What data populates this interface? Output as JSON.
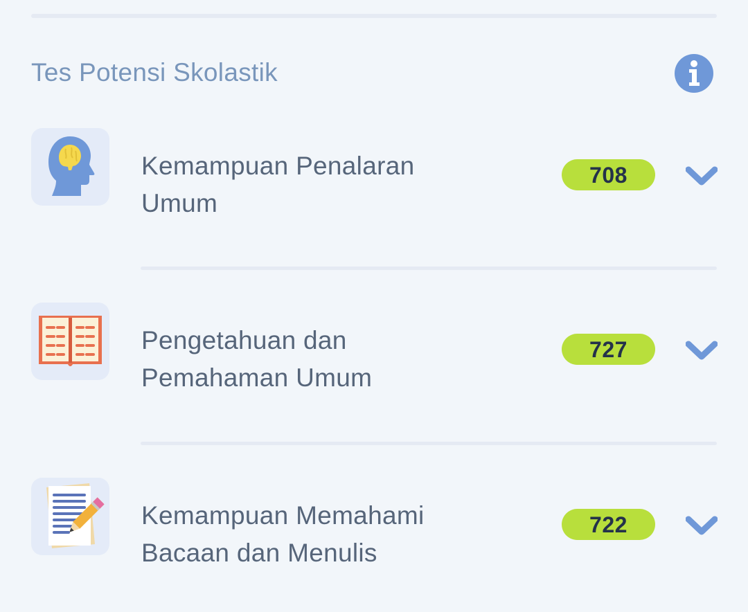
{
  "section": {
    "title": "Tes Potensi Skolastik",
    "info_icon": "info-icon"
  },
  "subtests": [
    {
      "label_line1": "Kemampuan Penalaran",
      "label_line2": "Umum",
      "score": "708",
      "icon": "head-brain-icon"
    },
    {
      "label_line1": "Pengetahuan dan",
      "label_line2": "Pemahaman Umum",
      "score": "727",
      "icon": "open-book-icon"
    },
    {
      "label_line1": "Kemampuan Memahami",
      "label_line2": "Bacaan dan Menulis",
      "score": "722",
      "icon": "paper-pencil-icon"
    }
  ],
  "colors": {
    "background": "#f2f6fa",
    "title": "#7996bb",
    "label": "#56657a",
    "badge": "#b8df3c",
    "badge_text": "#24324a",
    "accent": "#6f98d8",
    "icon_box": "#e4ebf8"
  }
}
